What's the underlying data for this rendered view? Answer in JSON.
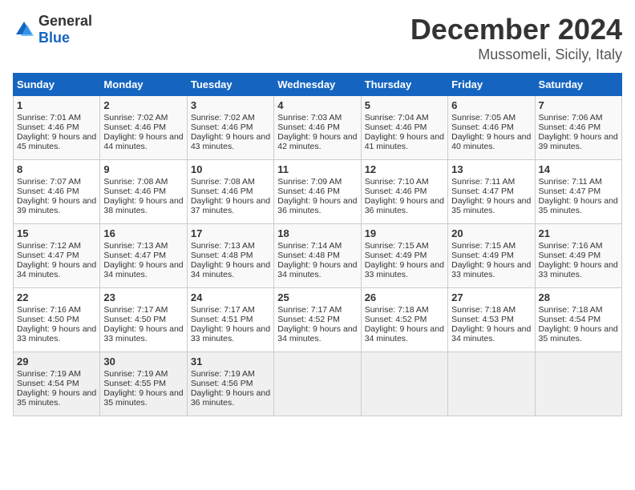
{
  "logo": {
    "text_general": "General",
    "text_blue": "Blue"
  },
  "header": {
    "month": "December 2024",
    "location": "Mussomeli, Sicily, Italy"
  },
  "weekdays": [
    "Sunday",
    "Monday",
    "Tuesday",
    "Wednesday",
    "Thursday",
    "Friday",
    "Saturday"
  ],
  "weeks": [
    [
      {
        "day": "1",
        "sunrise": "Sunrise: 7:01 AM",
        "sunset": "Sunset: 4:46 PM",
        "daylight": "Daylight: 9 hours and 45 minutes."
      },
      {
        "day": "2",
        "sunrise": "Sunrise: 7:02 AM",
        "sunset": "Sunset: 4:46 PM",
        "daylight": "Daylight: 9 hours and 44 minutes."
      },
      {
        "day": "3",
        "sunrise": "Sunrise: 7:02 AM",
        "sunset": "Sunset: 4:46 PM",
        "daylight": "Daylight: 9 hours and 43 minutes."
      },
      {
        "day": "4",
        "sunrise": "Sunrise: 7:03 AM",
        "sunset": "Sunset: 4:46 PM",
        "daylight": "Daylight: 9 hours and 42 minutes."
      },
      {
        "day": "5",
        "sunrise": "Sunrise: 7:04 AM",
        "sunset": "Sunset: 4:46 PM",
        "daylight": "Daylight: 9 hours and 41 minutes."
      },
      {
        "day": "6",
        "sunrise": "Sunrise: 7:05 AM",
        "sunset": "Sunset: 4:46 PM",
        "daylight": "Daylight: 9 hours and 40 minutes."
      },
      {
        "day": "7",
        "sunrise": "Sunrise: 7:06 AM",
        "sunset": "Sunset: 4:46 PM",
        "daylight": "Daylight: 9 hours and 39 minutes."
      }
    ],
    [
      {
        "day": "8",
        "sunrise": "Sunrise: 7:07 AM",
        "sunset": "Sunset: 4:46 PM",
        "daylight": "Daylight: 9 hours and 39 minutes."
      },
      {
        "day": "9",
        "sunrise": "Sunrise: 7:08 AM",
        "sunset": "Sunset: 4:46 PM",
        "daylight": "Daylight: 9 hours and 38 minutes."
      },
      {
        "day": "10",
        "sunrise": "Sunrise: 7:08 AM",
        "sunset": "Sunset: 4:46 PM",
        "daylight": "Daylight: 9 hours and 37 minutes."
      },
      {
        "day": "11",
        "sunrise": "Sunrise: 7:09 AM",
        "sunset": "Sunset: 4:46 PM",
        "daylight": "Daylight: 9 hours and 36 minutes."
      },
      {
        "day": "12",
        "sunrise": "Sunrise: 7:10 AM",
        "sunset": "Sunset: 4:46 PM",
        "daylight": "Daylight: 9 hours and 36 minutes."
      },
      {
        "day": "13",
        "sunrise": "Sunrise: 7:11 AM",
        "sunset": "Sunset: 4:47 PM",
        "daylight": "Daylight: 9 hours and 35 minutes."
      },
      {
        "day": "14",
        "sunrise": "Sunrise: 7:11 AM",
        "sunset": "Sunset: 4:47 PM",
        "daylight": "Daylight: 9 hours and 35 minutes."
      }
    ],
    [
      {
        "day": "15",
        "sunrise": "Sunrise: 7:12 AM",
        "sunset": "Sunset: 4:47 PM",
        "daylight": "Daylight: 9 hours and 34 minutes."
      },
      {
        "day": "16",
        "sunrise": "Sunrise: 7:13 AM",
        "sunset": "Sunset: 4:47 PM",
        "daylight": "Daylight: 9 hours and 34 minutes."
      },
      {
        "day": "17",
        "sunrise": "Sunrise: 7:13 AM",
        "sunset": "Sunset: 4:48 PM",
        "daylight": "Daylight: 9 hours and 34 minutes."
      },
      {
        "day": "18",
        "sunrise": "Sunrise: 7:14 AM",
        "sunset": "Sunset: 4:48 PM",
        "daylight": "Daylight: 9 hours and 34 minutes."
      },
      {
        "day": "19",
        "sunrise": "Sunrise: 7:15 AM",
        "sunset": "Sunset: 4:49 PM",
        "daylight": "Daylight: 9 hours and 33 minutes."
      },
      {
        "day": "20",
        "sunrise": "Sunrise: 7:15 AM",
        "sunset": "Sunset: 4:49 PM",
        "daylight": "Daylight: 9 hours and 33 minutes."
      },
      {
        "day": "21",
        "sunrise": "Sunrise: 7:16 AM",
        "sunset": "Sunset: 4:49 PM",
        "daylight": "Daylight: 9 hours and 33 minutes."
      }
    ],
    [
      {
        "day": "22",
        "sunrise": "Sunrise: 7:16 AM",
        "sunset": "Sunset: 4:50 PM",
        "daylight": "Daylight: 9 hours and 33 minutes."
      },
      {
        "day": "23",
        "sunrise": "Sunrise: 7:17 AM",
        "sunset": "Sunset: 4:50 PM",
        "daylight": "Daylight: 9 hours and 33 minutes."
      },
      {
        "day": "24",
        "sunrise": "Sunrise: 7:17 AM",
        "sunset": "Sunset: 4:51 PM",
        "daylight": "Daylight: 9 hours and 33 minutes."
      },
      {
        "day": "25",
        "sunrise": "Sunrise: 7:17 AM",
        "sunset": "Sunset: 4:52 PM",
        "daylight": "Daylight: 9 hours and 34 minutes."
      },
      {
        "day": "26",
        "sunrise": "Sunrise: 7:18 AM",
        "sunset": "Sunset: 4:52 PM",
        "daylight": "Daylight: 9 hours and 34 minutes."
      },
      {
        "day": "27",
        "sunrise": "Sunrise: 7:18 AM",
        "sunset": "Sunset: 4:53 PM",
        "daylight": "Daylight: 9 hours and 34 minutes."
      },
      {
        "day": "28",
        "sunrise": "Sunrise: 7:18 AM",
        "sunset": "Sunset: 4:54 PM",
        "daylight": "Daylight: 9 hours and 35 minutes."
      }
    ],
    [
      {
        "day": "29",
        "sunrise": "Sunrise: 7:19 AM",
        "sunset": "Sunset: 4:54 PM",
        "daylight": "Daylight: 9 hours and 35 minutes."
      },
      {
        "day": "30",
        "sunrise": "Sunrise: 7:19 AM",
        "sunset": "Sunset: 4:55 PM",
        "daylight": "Daylight: 9 hours and 35 minutes."
      },
      {
        "day": "31",
        "sunrise": "Sunrise: 7:19 AM",
        "sunset": "Sunset: 4:56 PM",
        "daylight": "Daylight: 9 hours and 36 minutes."
      },
      null,
      null,
      null,
      null
    ]
  ]
}
